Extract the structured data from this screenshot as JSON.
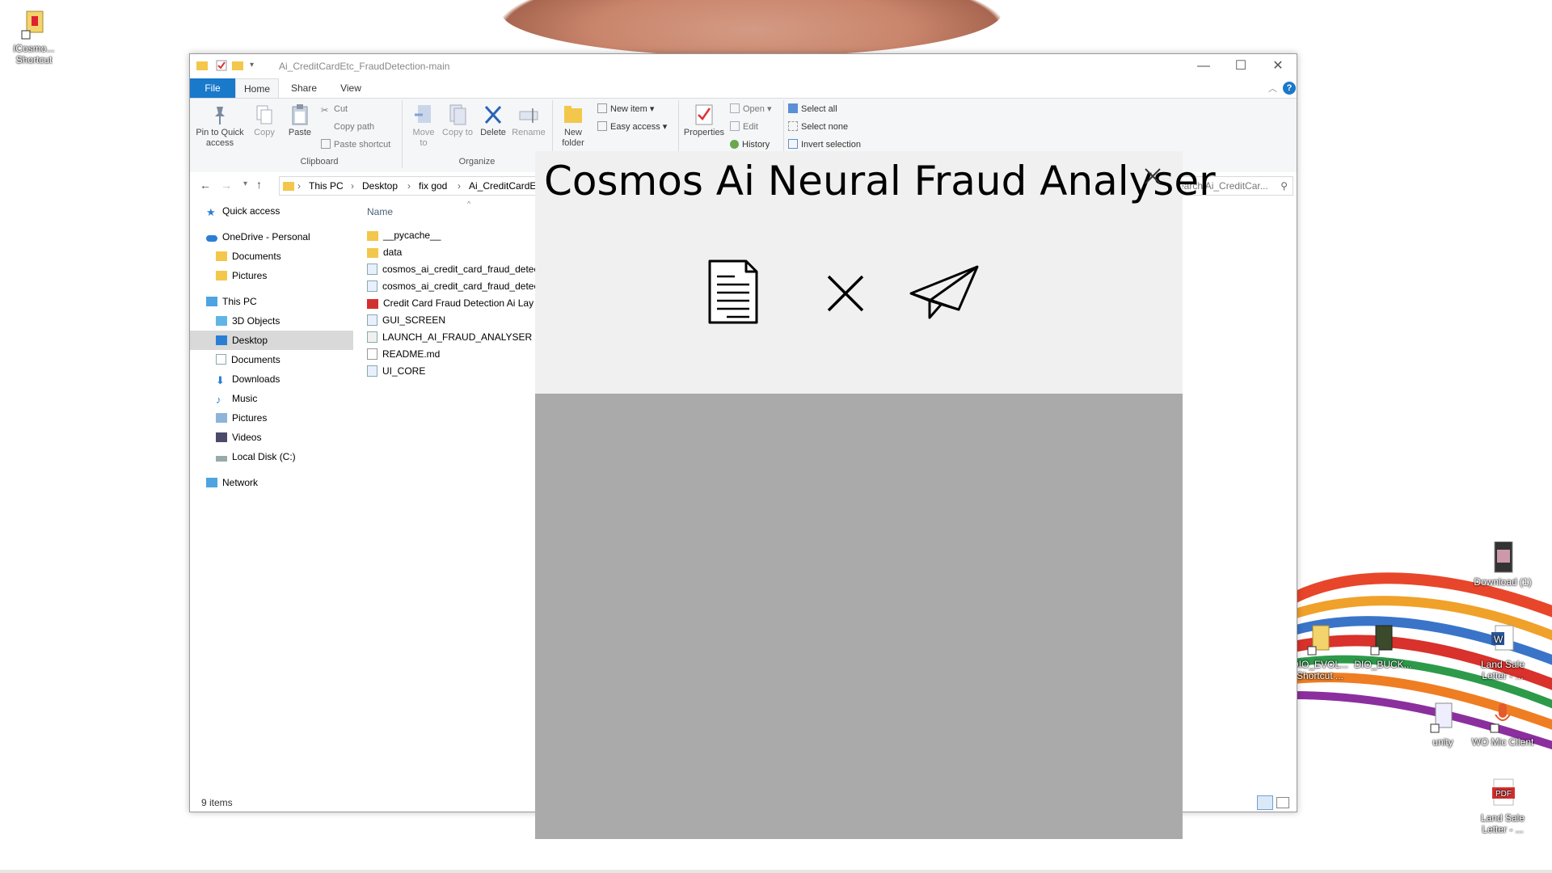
{
  "desktop": {
    "icons_left": [
      {
        "label": "iCosmo... Shortcut",
        "icon": "shortcut-icon"
      }
    ],
    "icons_right": [
      {
        "label": "Download (1)",
        "icon": "image-file-icon"
      },
      {
        "label": "DIO_EVOL... Shortcut ...",
        "icon": "shortcut-icon"
      },
      {
        "label": "DIO_BUCK...",
        "icon": "shortcut-icon"
      },
      {
        "label": "Land Sale Letter - ...",
        "icon": "word-doc-icon"
      },
      {
        "label": "unity",
        "icon": "shortcut-icon"
      },
      {
        "label": "WO Mic Client",
        "icon": "microphone-icon"
      },
      {
        "label": "Land Sale Letter - ...",
        "icon": "pdf-icon"
      }
    ]
  },
  "explorer": {
    "title": "Ai_CreditCardEtc_FraudDetection-main",
    "tabs": [
      "File",
      "Home",
      "Share",
      "View"
    ],
    "ribbon": {
      "clipboard": {
        "group_label": "Clipboard",
        "pin": "Pin to Quick access",
        "copy": "Copy",
        "paste": "Paste",
        "cut": "Cut",
        "copy_path": "Copy path",
        "paste_shortcut": "Paste shortcut"
      },
      "organize": {
        "group_label": "Organize",
        "move_to": "Move to",
        "copy_to": "Copy to",
        "delete": "Delete",
        "rename": "Rename"
      },
      "new": {
        "new_folder": "New folder",
        "new_item": "New item",
        "easy_access": "Easy access"
      },
      "open": {
        "properties": "Properties",
        "open": "Open",
        "edit": "Edit",
        "history": "History"
      },
      "select": {
        "select_all": "Select all",
        "select_none": "Select none",
        "invert_selection": "Invert selection"
      }
    },
    "breadcrumb": [
      "This PC",
      "Desktop",
      "fix god",
      "Ai_CreditCardEtc_"
    ],
    "search_placeholder": "earch Ai_CreditCar...",
    "nav": {
      "quick_access": "Quick access",
      "onedrive": "OneDrive - Personal",
      "od_documents": "Documents",
      "od_pictures": "Pictures",
      "this_pc": "This PC",
      "objects3d": "3D Objects",
      "desktop": "Desktop",
      "documents": "Documents",
      "downloads": "Downloads",
      "music": "Music",
      "pictures": "Pictures",
      "videos": "Videos",
      "local_disk": "Local Disk (C:)",
      "network": "Network"
    },
    "column_name": "Name",
    "files": [
      {
        "name": "__pycache__",
        "icon": "folder-icon"
      },
      {
        "name": "data",
        "icon": "folder-icon"
      },
      {
        "name": "cosmos_ai_credit_card_fraud_detec",
        "icon": "python-file-icon"
      },
      {
        "name": "cosmos_ai_credit_card_fraud_detec",
        "icon": "python-file-icon"
      },
      {
        "name": "Credit Card Fraud Detection Ai Lay",
        "icon": "pdf-icon"
      },
      {
        "name": "GUI_SCREEN",
        "icon": "python-file-icon"
      },
      {
        "name": "LAUNCH_AI_FRAUD_ANALYSER",
        "icon": "script-file-icon"
      },
      {
        "name": "README.md",
        "icon": "text-file-icon"
      },
      {
        "name": "UI_CORE",
        "icon": "python-file-icon"
      }
    ],
    "status": "9 items"
  },
  "app": {
    "title": "Cosmos Ai Neural Fraud Analyser",
    "buttons": [
      {
        "icon": "document-icon"
      },
      {
        "icon": "close-x-icon"
      },
      {
        "icon": "paper-plane-icon"
      }
    ],
    "colors": {
      "panel": "#f0f0f0",
      "output_area": "#aaaaaa"
    }
  }
}
